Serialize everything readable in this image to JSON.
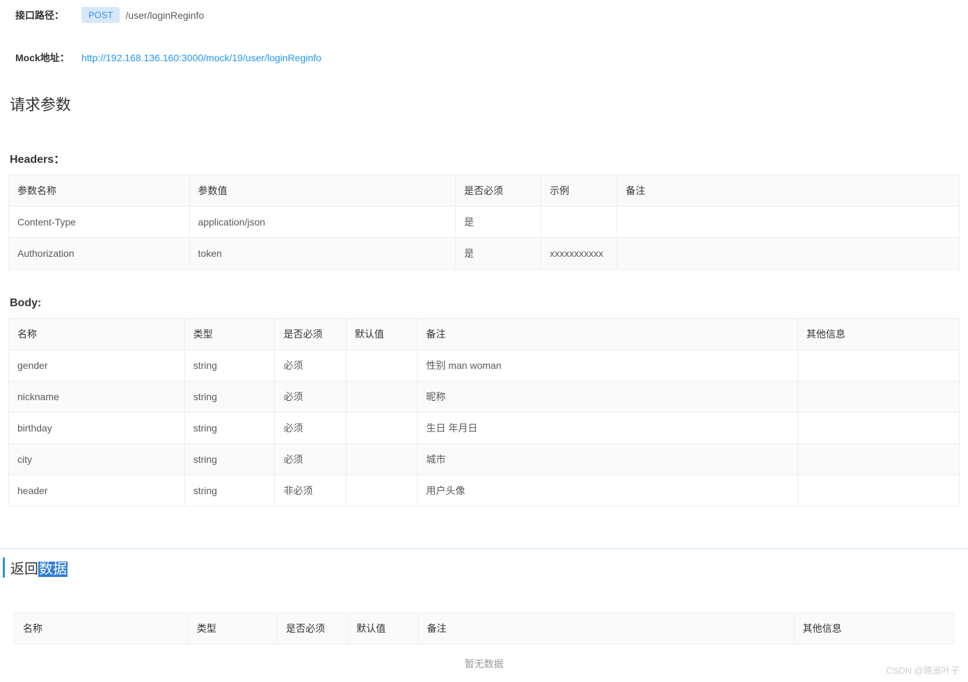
{
  "api": {
    "path_label": "接口路径：",
    "method": "POST",
    "path": "/user/loginReginfo",
    "mock_label": "Mock地址：",
    "mock_url": "http://192.168.136.160:3000/mock/19/user/loginReginfo"
  },
  "request": {
    "title": "请求参数",
    "headers_title": "Headers：",
    "headers_columns": [
      "参数名称",
      "参数值",
      "是否必须",
      "示例",
      "备注"
    ],
    "headers_rows": [
      {
        "name": "Content-Type",
        "value": "application/json",
        "required": "是",
        "example": "",
        "remark": ""
      },
      {
        "name": "Authorization",
        "value": "token",
        "required": "是",
        "example": "xxxxxxxxxxx",
        "remark": ""
      }
    ],
    "body_title": "Body:",
    "body_columns": [
      "名称",
      "类型",
      "是否必须",
      "默认值",
      "备注",
      "其他信息"
    ],
    "body_rows": [
      {
        "name": "gender",
        "type": "string",
        "required": "必须",
        "default": "",
        "remark": "性别 man woman",
        "other": ""
      },
      {
        "name": "nickname",
        "type": "string",
        "required": "必须",
        "default": "",
        "remark": "昵称",
        "other": ""
      },
      {
        "name": "birthday",
        "type": "string",
        "required": "必须",
        "default": "",
        "remark": "生日 年月日",
        "other": ""
      },
      {
        "name": "city",
        "type": "string",
        "required": "必须",
        "default": "",
        "remark": "城市",
        "other": ""
      },
      {
        "name": "header",
        "type": "string",
        "required": "非必须",
        "default": "",
        "remark": "用户头像",
        "other": ""
      }
    ]
  },
  "response": {
    "title_plain": "返回",
    "title_hl": "数据",
    "columns": [
      "名称",
      "类型",
      "是否必须",
      "默认值",
      "备注",
      "其他信息"
    ],
    "no_data": "暂无数据"
  },
  "watermark": "CSDN @路遥叶子"
}
